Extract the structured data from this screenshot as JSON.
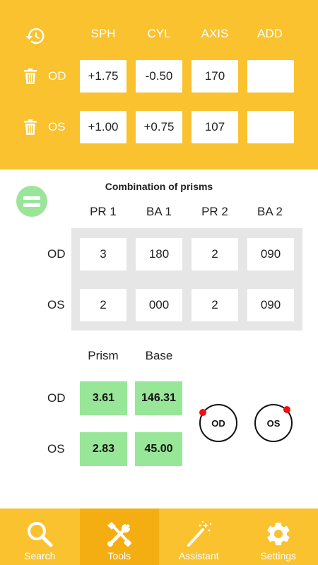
{
  "refraction": {
    "headers": [
      "SPH",
      "CYL",
      "AXIS",
      "ADD"
    ],
    "od": {
      "label": "OD",
      "sph": "+1.75",
      "cyl": "-0.50",
      "axis": "170",
      "add": ""
    },
    "os": {
      "label": "OS",
      "sph": "+1.00",
      "cyl": "+0.75",
      "axis": "107",
      "add": ""
    }
  },
  "prisms": {
    "title": "Combination of prisms",
    "headers": [
      "PR 1",
      "BA 1",
      "PR 2",
      "BA 2"
    ],
    "od": {
      "label": "OD",
      "pr1": "3",
      "ba1": "180",
      "pr2": "2",
      "ba2": "090"
    },
    "os": {
      "label": "OS",
      "pr1": "2",
      "ba1": "000",
      "pr2": "2",
      "ba2": "090"
    }
  },
  "result": {
    "headers": [
      "Prism",
      "Base"
    ],
    "od": {
      "label": "OD",
      "prism": "3.61",
      "base": "146.31"
    },
    "os": {
      "label": "OS",
      "prism": "2.83",
      "base": "45.00"
    }
  },
  "dials": {
    "od": {
      "label": "OD",
      "angle_deg": 146.31
    },
    "os": {
      "label": "OS",
      "angle_deg": 45.0
    }
  },
  "nav": {
    "items": [
      {
        "label": "Search",
        "icon": "search-icon",
        "active": false
      },
      {
        "label": "Tools",
        "icon": "tools-icon",
        "active": true
      },
      {
        "label": "Assistant",
        "icon": "magic-wand-icon",
        "active": false
      },
      {
        "label": "Settings",
        "icon": "gear-icon",
        "active": false
      }
    ]
  },
  "colors": {
    "accent": "#F9C22E",
    "accent_active": "#F5AE12",
    "result_green": "#98E698",
    "dial_dot": "#EE1111"
  }
}
